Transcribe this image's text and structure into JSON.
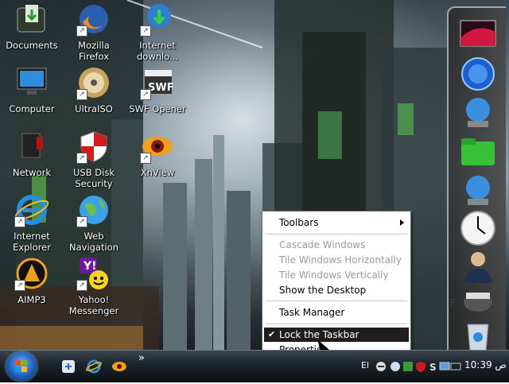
{
  "desktop": {
    "icons": [
      {
        "label": "Documents",
        "icon": "folder-icon"
      },
      {
        "label": "Mozilla Firefox",
        "icon": "firefox-icon"
      },
      {
        "label": "Internet downlo...",
        "icon": "download-manager-icon"
      },
      {
        "label": "Computer",
        "icon": "monitor-icon"
      },
      {
        "label": "UltraISO",
        "icon": "disc-icon"
      },
      {
        "label": "SWF Opener",
        "icon": "swf-icon"
      },
      {
        "label": "Network",
        "icon": "network-icon"
      },
      {
        "label": "USB Disk Security",
        "icon": "shield-icon"
      },
      {
        "label": "XnView",
        "icon": "xnview-icon"
      },
      {
        "label": "Internet Explorer",
        "icon": "ie-icon"
      },
      {
        "label": "Web Navigation",
        "icon": "globe-icon"
      },
      {
        "label": "AIMP3",
        "icon": "aimp-icon"
      },
      {
        "label": "Yahoo! Messenger",
        "icon": "yahoo-icon"
      }
    ],
    "partial_label": "F"
  },
  "context_menu": {
    "items": [
      {
        "label": "Toolbars",
        "has_submenu": true
      },
      {
        "label": "Cascade Windows",
        "disabled": true
      },
      {
        "label": "Tile Windows Horizontally",
        "disabled": true
      },
      {
        "label": "Tile Windows Vertically",
        "disabled": true
      },
      {
        "label": "Show the Desktop"
      },
      {
        "label": "Task Manager"
      },
      {
        "label": "Lock the Taskbar",
        "checked": true,
        "highlighted": true
      },
      {
        "label": "Properties"
      }
    ]
  },
  "taskbar": {
    "quicklaunch_more": "»",
    "lang": "El",
    "clock": "10:39 ص"
  },
  "colors": {
    "menu_highlight": "#1e1e1e",
    "taskbar": "#1b2228",
    "start_orb": "#1c5fc0"
  }
}
